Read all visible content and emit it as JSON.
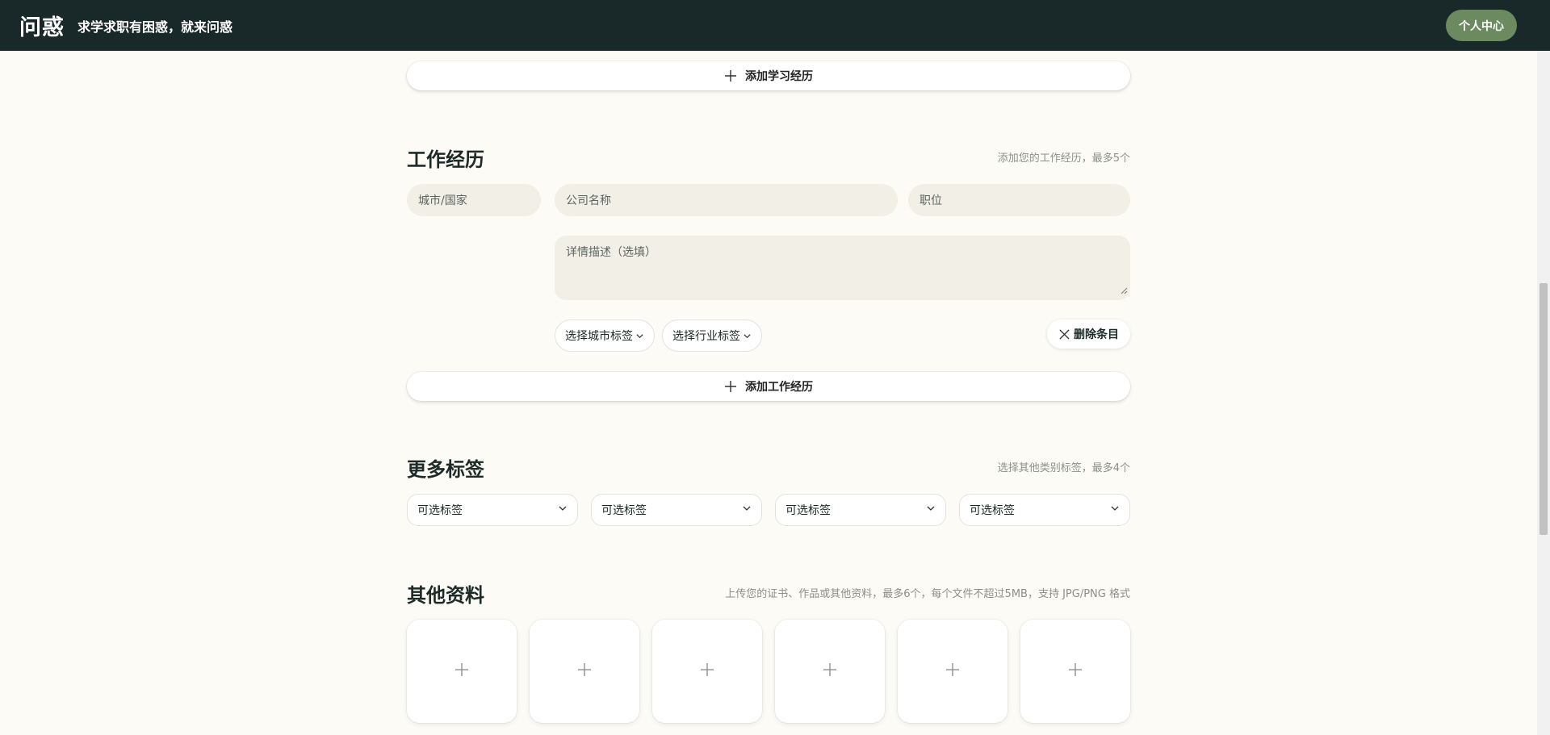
{
  "header": {
    "brand": "问惑",
    "tagline": "求学求职有困惑，就来问惑",
    "profile_button": "个人中心"
  },
  "education": {
    "add_button": "添加学习经历"
  },
  "work": {
    "title": "工作经历",
    "note": "添加您的工作经历，最多5个",
    "city_placeholder": "城市/国家",
    "company_placeholder": "公司名称",
    "position_placeholder": "职位",
    "description_placeholder": "详情描述（选填）",
    "city_tag_select": "选择城市标签",
    "industry_tag_select": "选择行业标签",
    "delete_button": "删除条目",
    "add_button": "添加工作经历"
  },
  "more_tags": {
    "title": "更多标签",
    "note": "选择其他类别标签，最多4个",
    "selects": [
      "可选标签",
      "可选标签",
      "可选标签",
      "可选标签"
    ]
  },
  "other_materials": {
    "title": "其他资料",
    "note": "上传您的证书、作品或其他资料，最多6个，每个文件不超过5MB，支持 JPG/PNG 格式",
    "upload_slots": 6
  },
  "icons": {
    "add": "plus-icon",
    "dropdown": "chevron-down-icon",
    "delete": "close-icon"
  },
  "colors": {
    "header_bg": "#19292a",
    "page_bg": "#fcfbf6",
    "accent_button": "#6b8a60",
    "field_bg": "#f1efe6"
  }
}
